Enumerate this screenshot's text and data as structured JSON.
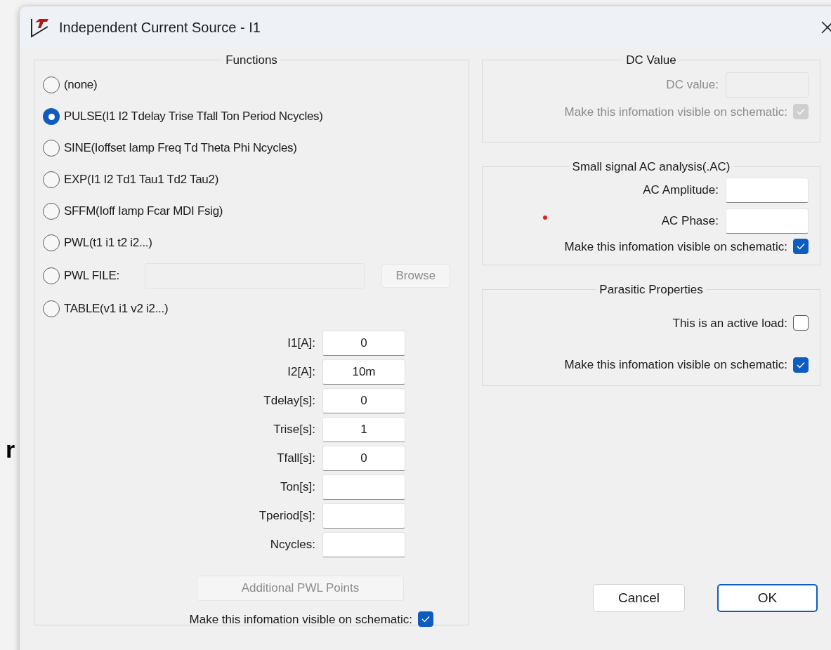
{
  "background_text": "r",
  "window": {
    "title": "Independent Current Source - I1"
  },
  "functions": {
    "title": "Functions",
    "options": [
      {
        "label": "(none)",
        "selected": false,
        "kind": "plain"
      },
      {
        "label": "PULSE(I1 I2 Tdelay Trise Tfall Ton Period Ncycles)",
        "selected": true,
        "kind": "plain"
      },
      {
        "label": "SINE(Ioffset Iamp Freq Td Theta Phi Ncycles)",
        "selected": false,
        "kind": "plain"
      },
      {
        "label": "EXP(I1 I2 Td1 Tau1 Td2 Tau2)",
        "selected": false,
        "kind": "plain"
      },
      {
        "label": "SFFM(Ioff Iamp Fcar MDI Fsig)",
        "selected": false,
        "kind": "plain"
      },
      {
        "label": "PWL(t1 i1 t2 i2...)",
        "selected": false,
        "kind": "plain"
      },
      {
        "label": "PWL FILE:",
        "selected": false,
        "kind": "file",
        "browse": {
          "label": "Browse",
          "disabled": true
        }
      },
      {
        "label": "TABLE(v1 i1 v2 i2...)",
        "selected": false,
        "kind": "plain"
      }
    ],
    "parameters": [
      {
        "label": "I1[A]:",
        "value": "0"
      },
      {
        "label": "I2[A]:",
        "value": "10m"
      },
      {
        "label": "Tdelay[s]:",
        "value": "0"
      },
      {
        "label": "Trise[s]:",
        "value": "1"
      },
      {
        "label": "Tfall[s]:",
        "value": "0"
      },
      {
        "label": "Ton[s]:"
      },
      {
        "label": "Tperiod[s]:"
      },
      {
        "label": "Ncycles:"
      }
    ],
    "pwl_points_button": {
      "label": "Additional PWL Points",
      "disabled": true
    },
    "visible": {
      "label": "Make this infomation visible on schematic:",
      "checked": true,
      "disabled": false
    }
  },
  "dc_value": {
    "title": "DC Value",
    "field_label": "DC value:",
    "disabled": true,
    "visible": {
      "label": "Make this infomation visible on schematic:",
      "checked": true,
      "disabled": true
    }
  },
  "ac_analysis": {
    "title": "Small signal AC analysis(.AC)",
    "fields": [
      {
        "label": "AC Amplitude:"
      },
      {
        "label": "AC Phase:"
      }
    ],
    "visible": {
      "label": "Make this infomation visible on schematic:",
      "checked": true,
      "disabled": false
    }
  },
  "parasitic": {
    "title": "Parasitic Properties",
    "checkboxes": [
      {
        "label": "This is an active load:",
        "checked": false,
        "disabled": false
      },
      {
        "label": "Make this infomation visible on schematic:",
        "checked": true,
        "disabled": false
      }
    ]
  },
  "buttons": [
    {
      "label": "Cancel",
      "default": false
    },
    {
      "label": "OK",
      "default": true
    }
  ]
}
